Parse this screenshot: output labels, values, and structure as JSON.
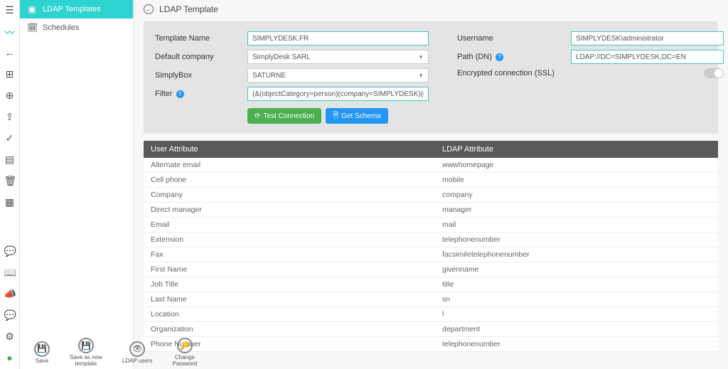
{
  "sidebar": {
    "templates": "LDAP Templates",
    "schedules": "Schedules"
  },
  "header": {
    "title": "LDAP Template"
  },
  "form": {
    "labels": {
      "templateName": "Template Name",
      "defaultCompany": "Default company",
      "simplyBox": "SimplyBox",
      "filter": "Filter",
      "username": "Username",
      "pathDn": "Path (DN)",
      "encrypted": "Encrypted connection (SSL)"
    },
    "values": {
      "templateName": "SIMPLYDESK.FR",
      "defaultCompany": "SimplyDesk SARL",
      "simplyBox": "SATURNE",
      "filter": "(&(objectCategory=person)(company=SIMPLYDESK)(objectClass=use",
      "username": "SIMPLYDESK\\administrator",
      "pathDn": "LDAP://DC=SIMPLYDESK,DC=EN"
    },
    "buttons": {
      "testConnection": "Test Connection",
      "getSchema": "Get Schema"
    }
  },
  "table": {
    "headers": {
      "user": "User Attribute",
      "ldap": "LDAP Attribute"
    },
    "rows": [
      {
        "user": "Alternate email",
        "ldap": "wwwhomepage"
      },
      {
        "user": "Cell phone",
        "ldap": "mobile"
      },
      {
        "user": "Company",
        "ldap": "company"
      },
      {
        "user": "Direct manager",
        "ldap": "manager"
      },
      {
        "user": "Email",
        "ldap": "mail"
      },
      {
        "user": "Extension",
        "ldap": "telephonenumber"
      },
      {
        "user": "Fax",
        "ldap": "facsimiletelephonenumber"
      },
      {
        "user": "First Name",
        "ldap": "givenname"
      },
      {
        "user": "Job Title",
        "ldap": "title"
      },
      {
        "user": "Last Name",
        "ldap": "sn"
      },
      {
        "user": "Location",
        "ldap": "l"
      },
      {
        "user": "Organization",
        "ldap": "department"
      },
      {
        "user": "Phone Number",
        "ldap": "telephonenumber"
      }
    ]
  },
  "actions": {
    "save": "Save",
    "saveAsNew": "Save as new\ntemplate",
    "ldapUsers": "LDAP users",
    "changePassword": "Change\nPassword"
  },
  "icons": {
    "menu": "☰",
    "back": "←",
    "dash": "⊞",
    "plus": "⊕",
    "share": "⇪",
    "check": "✓",
    "bar": "▤",
    "trash": "🗑",
    "grid": "▦",
    "chat": "💬",
    "book": "📖",
    "bull": "📣",
    "comment": "💬",
    "gear": "⚙",
    "dot": "●",
    "arrowLeft": "←",
    "floppy": "💾",
    "eye": "👁",
    "key": "🔑",
    "refresh": "⟳",
    "file": "🗎",
    "calendar": "🗓",
    "users": "👥"
  }
}
